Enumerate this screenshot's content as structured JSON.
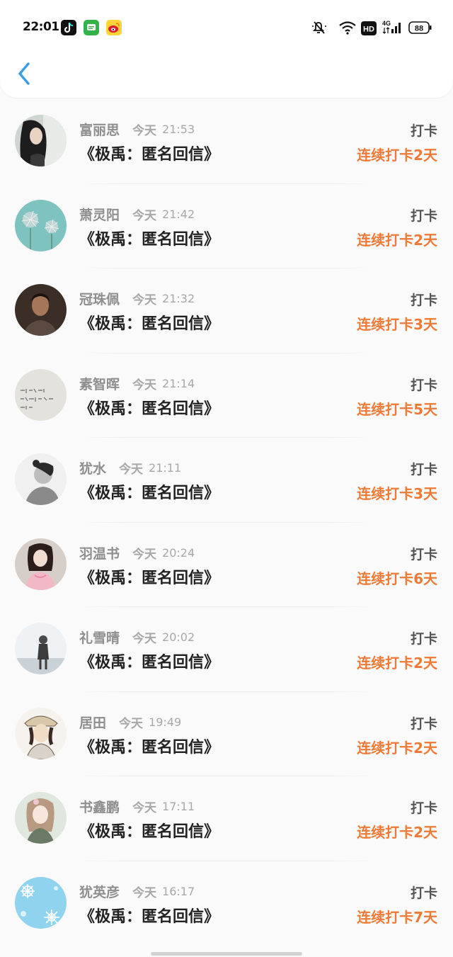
{
  "status": {
    "time": "22:01",
    "battery": "88",
    "network": "4G",
    "hd": "HD",
    "apps": [
      "tiktok-icon",
      "chat-icon",
      "weibo-icon"
    ]
  },
  "header": {
    "back_icon": "chevron-left-icon"
  },
  "rows": [
    {
      "name": "富丽思",
      "day": "今天",
      "time": "21:53",
      "book": "《极禹：匿名回信》",
      "action": "打卡",
      "streak": "连续打卡2天",
      "avatar": "portrait-dark-hair"
    },
    {
      "name": "萧灵阳",
      "day": "今天",
      "time": "21:42",
      "book": "《极禹：匿名回信》",
      "action": "打卡",
      "streak": "连续打卡2天",
      "avatar": "dandelion"
    },
    {
      "name": "冠珠佩",
      "day": "今天",
      "time": "21:32",
      "book": "《极禹：匿名回信》",
      "action": "打卡",
      "streak": "连续打卡3天",
      "avatar": "young-man"
    },
    {
      "name": "素智晖",
      "day": "今天",
      "time": "21:14",
      "book": "《极禹：匿名回信》",
      "action": "打卡",
      "streak": "连续打卡5天",
      "avatar": "handwriting"
    },
    {
      "name": "犹水",
      "day": "今天",
      "time": "21:11",
      "book": "《极禹：匿名回信》",
      "action": "打卡",
      "streak": "连续打卡3天",
      "avatar": "bw-portrait"
    },
    {
      "name": "羽温书",
      "day": "今天",
      "time": "20:24",
      "book": "《极禹：匿名回信》",
      "action": "打卡",
      "streak": "连续打卡6天",
      "avatar": "girl-pink"
    },
    {
      "name": "礼雪晴",
      "day": "今天",
      "time": "20:02",
      "book": "《极禹：匿名回信》",
      "action": "打卡",
      "streak": "连续打卡2天",
      "avatar": "sky-figure"
    },
    {
      "name": "居田",
      "day": "今天",
      "time": "19:49",
      "book": "《极禹：匿名回信》",
      "action": "打卡",
      "streak": "连续打卡2天",
      "avatar": "anime-boy"
    },
    {
      "name": "书鑫鹏",
      "day": "今天",
      "time": "17:11",
      "book": "《极禹：匿名回信》",
      "action": "打卡",
      "streak": "连续打卡2天",
      "avatar": "girl-light"
    },
    {
      "name": "犹英彦",
      "day": "今天",
      "time": "16:17",
      "book": "《极禹：匿名回信》",
      "action": "打卡",
      "streak": "连续打卡7天",
      "avatar": "snowflake-blue"
    }
  ],
  "colors": {
    "accent": "#f07a35",
    "back": "#3a9be8"
  }
}
